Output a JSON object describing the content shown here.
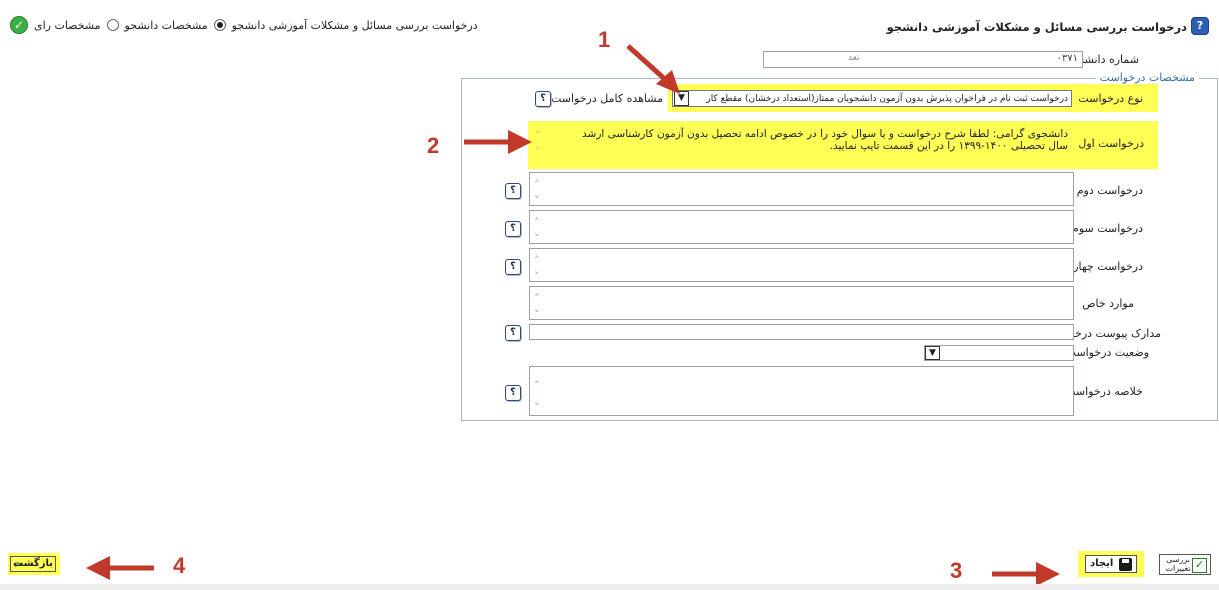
{
  "header": {
    "title": "درخواست بررسی مسائل و مشکلات آموزشی دانشجو",
    "help_icon": "help-icon",
    "nav": {
      "link_text": "درخواست بررسی مسائل و مشکلات آموزشی دانشجو",
      "radio_student_label": "مشخصات دانشجو",
      "radio_vote_label": "مشخصات رای",
      "ok_icon": "check-icon"
    }
  },
  "student": {
    "label": "شماره دانشجو",
    "value_masked": "۰۳۷۱",
    "value_hint": "تعد"
  },
  "fieldset": {
    "legend": "مشخصات درخواست"
  },
  "form": {
    "request_type_label": "نوع درخواست",
    "request_type_value": "درخواست ثبت نام در فراخوان پذیرش بدون آزمون دانشجویان ممتاز(استعداد درخشان) مقطع کار",
    "view_full_label": "مشاهده کامل درخواست",
    "first_request_label": "درخواست اول",
    "first_request_text": "دانشجوی گرامی: لطفا شرح درخواست و یا سوال خود را در خصوص ادامه تحصیل بدون آزمون کارشناسی ارشد سال تحصیلی ۱۴۰۰-۱۳۹۹ را در این قسمت تایپ نمایید.",
    "second_request_label": "درخواست دوم",
    "third_request_label": "درخواست سوم",
    "fourth_request_label": "درخواست چهارم",
    "special_cases_label": "موارد خاص",
    "attachments_label": "مدارک پیوست درخواست",
    "status_label": "وضعیت درخواست",
    "summary_label": "خلاصه درخواست",
    "help_glyph": "؟"
  },
  "buttons": {
    "create_label": "ایجاد",
    "review_label": "بررسی تغییرات",
    "back_label": "بازگشت"
  },
  "annotations": {
    "n1": "1",
    "n2": "2",
    "n3": "3",
    "n4": "4"
  },
  "colors": {
    "highlight": "#ffff55",
    "annotation": "#c0392b",
    "legend": "#3a6ea5"
  }
}
